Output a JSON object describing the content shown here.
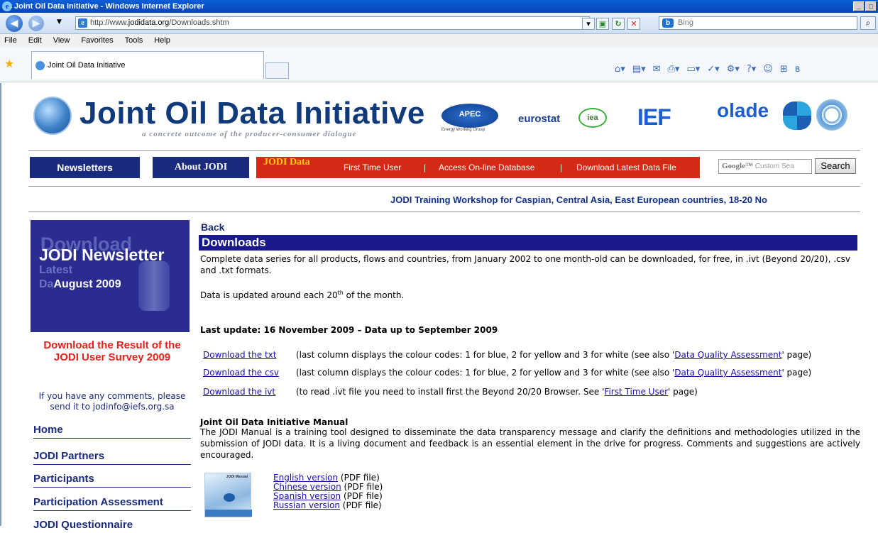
{
  "window": {
    "title": "Joint Oil Data Initiative - Windows Internet Explorer",
    "buttons": [
      "_",
      "□"
    ]
  },
  "browser": {
    "address_prefix": "http://www.",
    "address_domain": "jodidata.org",
    "address_path": "/Downloads.shtm",
    "search_placeholder": "Bing",
    "menu": [
      "File",
      "Edit",
      "View",
      "Favorites",
      "Tools",
      "Help"
    ],
    "tab_title": "Joint Oil Data Initiative"
  },
  "header": {
    "logo_text": "Joint Oil Data Initiative",
    "tagline": "a concrete outcome of the producer-consumer dialogue",
    "partners": {
      "apec": "APEC",
      "apec_sub": "Energy Working Group",
      "eurostat": "eurostat",
      "iea": "iea",
      "ief": "IEF",
      "olade": "olade"
    }
  },
  "nav": {
    "newsletters": "Newsletters",
    "about": "About JODI",
    "jodi_data": "JODI Data",
    "first_time_user": "First Time User",
    "sep1": "|",
    "access_db": "Access On-line Database",
    "sep2": "|",
    "download_latest": "Download Latest Data File",
    "search_placeholder": "Custom Sea",
    "search_google": "Google™",
    "search_button": "Search"
  },
  "ticker": "JODI Training Workshop for Caspian, Central Asia, East European countries, 18-20 No",
  "sidebar": {
    "banner": {
      "ghost1": "Download",
      "ghost2": "Latest",
      "ghost3": "Da",
      "title": "JODI Newsletter",
      "sub1": "Latest",
      "sub2": "August 2009"
    },
    "survey": "Download the Result of the JODI User Survey 2009",
    "comment": "If you have any comments, please send it to jodinfo@iefs.org.sa",
    "items": [
      "Home",
      "JODI Partners",
      "Participants",
      "Participation Assessment",
      "JODI Questionnaire"
    ]
  },
  "main": {
    "back": "Back",
    "heading": "Downloads",
    "intro": "Complete data series for all products, flows and countries, from January 2002 to one month-old can be downloaded, for free, in .ivt (Beyond 20/20), .csv and .txt formats.",
    "update_pre": "Data is updated around each 20",
    "update_sup": "th",
    "update_post": " of the month.",
    "last_update": "Last update:  16 November 2009 – Data up to September 2009",
    "downloads": [
      {
        "link": "Download the txt",
        "pre": "(last column displays the colour codes: 1 for blue, 2 for yellow and 3 for white (see also '",
        "anchor": "Data Quality Assessment",
        "post": "' page)"
      },
      {
        "link": "Download the csv",
        "pre": "(last column displays the colour codes: 1 for blue, 2 for yellow and 3 for white (see also '",
        "anchor": "Data Quality Assessment",
        "post": "' page)"
      },
      {
        "link": "Download the ivt",
        "pre": "(to read .ivt file you need to install first the Beyond 20/20 Browser. See '",
        "anchor": "First Time User",
        "post": "' page)"
      }
    ],
    "manual_title": "Joint Oil Data Initiative Manual",
    "manual_text": "The JODI Manual is a training tool designed to disseminate the data transparency message and clarify the definitions and methodologies utilized in the submission of JODI data. It is a living document and feedback is an essential element in the drive for progress. Comments and suggestions are actively encouraged.",
    "book_label": "JODI Manual",
    "versions": [
      {
        "link": "English version",
        "suffix": " (PDF file)"
      },
      {
        "link": "Chinese version",
        "suffix": " (PDF file)"
      },
      {
        "link": "Spanish version",
        "suffix": " (PDF file)"
      },
      {
        "link": "Russian version",
        "suffix": " (PDF file)"
      }
    ]
  }
}
